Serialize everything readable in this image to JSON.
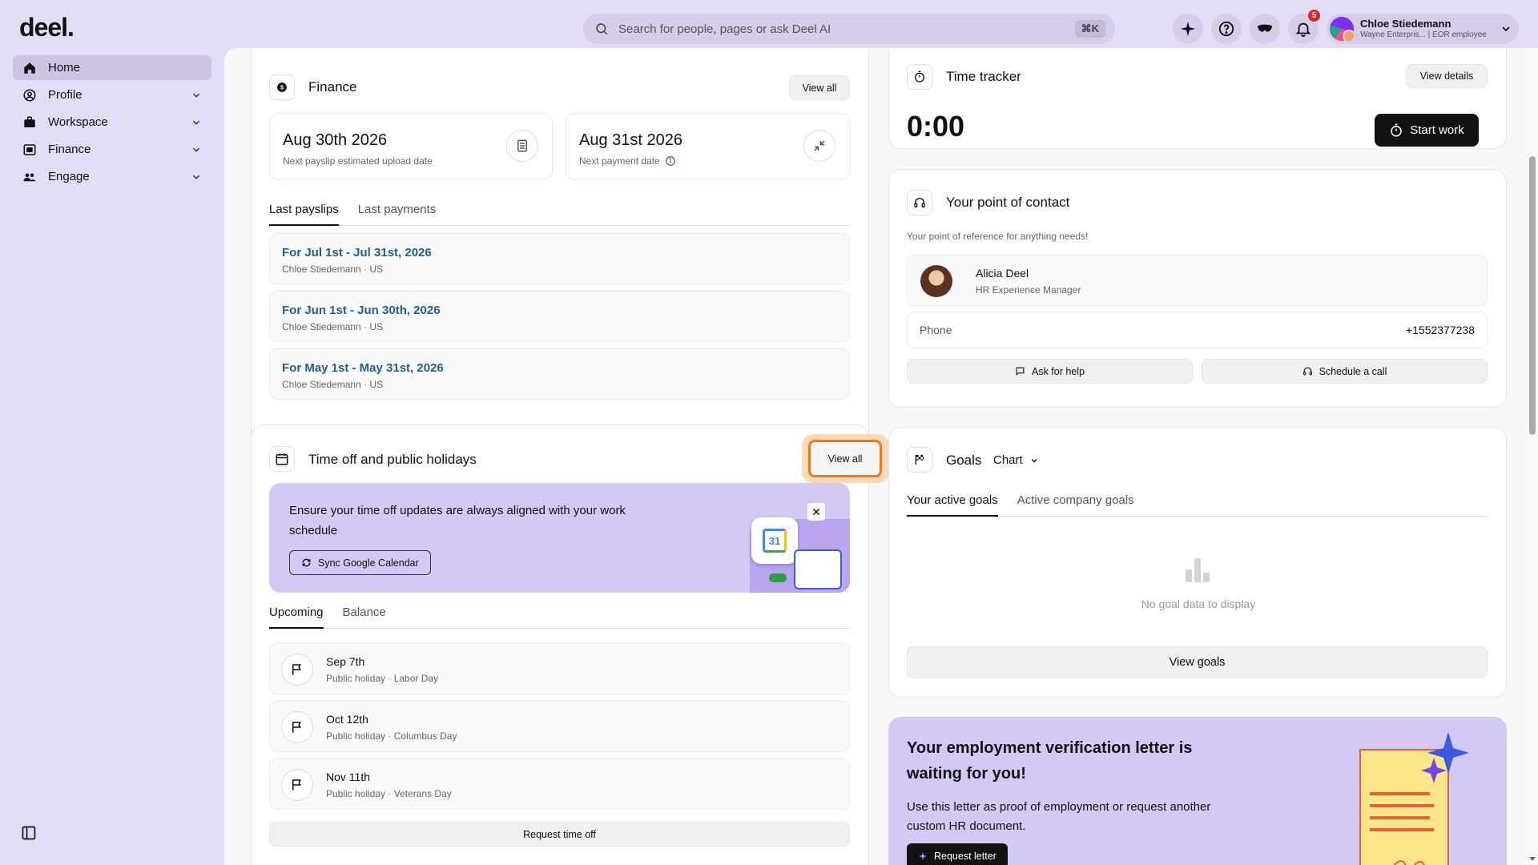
{
  "brand": {
    "logo": "deel."
  },
  "topbar": {
    "search_placeholder": "Search for people, pages or ask Deel AI",
    "search_shortcut": "⌘K",
    "notifications_count": "5",
    "user_name": "Chloe Stiedemann",
    "user_sub": "Wayne Enterpris... | EOR employee"
  },
  "sidebar": {
    "items": [
      {
        "label": "Home",
        "icon": "home-icon"
      },
      {
        "label": "Profile",
        "icon": "profile-icon"
      },
      {
        "label": "Workspace",
        "icon": "briefcase-icon"
      },
      {
        "label": "Finance",
        "icon": "finance-icon"
      },
      {
        "label": "Engage",
        "icon": "people-icon"
      }
    ]
  },
  "finance": {
    "title": "Finance",
    "view_all": "View all",
    "next_payslip_date": "Aug 30th 2026",
    "next_payslip_label": "Next payslip estimated upload date",
    "next_payment_date": "Aug 31st 2026",
    "next_payment_label": "Next payment date",
    "tabs": [
      "Last payslips",
      "Last payments"
    ],
    "payslips": [
      {
        "period": "For Jul 1st - Jul 31st, 2026",
        "sub": "Chloe Stiedemann · US"
      },
      {
        "period": "For Jun 1st - Jun 30th, 2026",
        "sub": "Chloe Stiedemann · US"
      },
      {
        "period": "For May 1st - May 31st, 2026",
        "sub": "Chloe Stiedemann · US"
      }
    ]
  },
  "timeoff": {
    "title": "Time off and public holidays",
    "view_all": "View all",
    "banner_text": "Ensure your time off updates are always aligned with your work schedule",
    "sync_button": "Sync Google Calendar",
    "calendar_day": "31",
    "tabs": [
      "Upcoming",
      "Balance"
    ],
    "holidays": [
      {
        "date": "Sep 7th",
        "sub": "Public holiday · Labor Day"
      },
      {
        "date": "Oct 12th",
        "sub": "Public holiday · Columbus Day"
      },
      {
        "date": "Nov 11th",
        "sub": "Public holiday · Veterans Day"
      }
    ],
    "request_button": "Request time off"
  },
  "tracker": {
    "title": "Time tracker",
    "view_details": "View details",
    "time": "0:00",
    "start_button": "Start work"
  },
  "contact": {
    "title": "Your point of contact",
    "subtitle": "Your point of reference for anything needs!",
    "name": "Alicia Deel",
    "role": "HR Experience Manager",
    "phone_label": "Phone",
    "phone_value": "+1552377238",
    "ask_help": "Ask for help",
    "schedule_call": "Schedule a call"
  },
  "goals": {
    "title": "Goals",
    "view_mode": "Chart",
    "tabs": [
      "Your active goals",
      "Active company goals"
    ],
    "empty_text": "No goal data to display",
    "view_goals": "View goals"
  },
  "letter": {
    "title": "Your employment verification letter is waiting for you!",
    "body": "Use this letter as proof of employment or request another custom HR document.",
    "button": "Request letter"
  },
  "colors": {
    "accent_purple": "#e3dcf7",
    "highlight_orange": "#f07a1a",
    "link_blue": "#1e5fa0",
    "badge_red": "#e02424"
  }
}
